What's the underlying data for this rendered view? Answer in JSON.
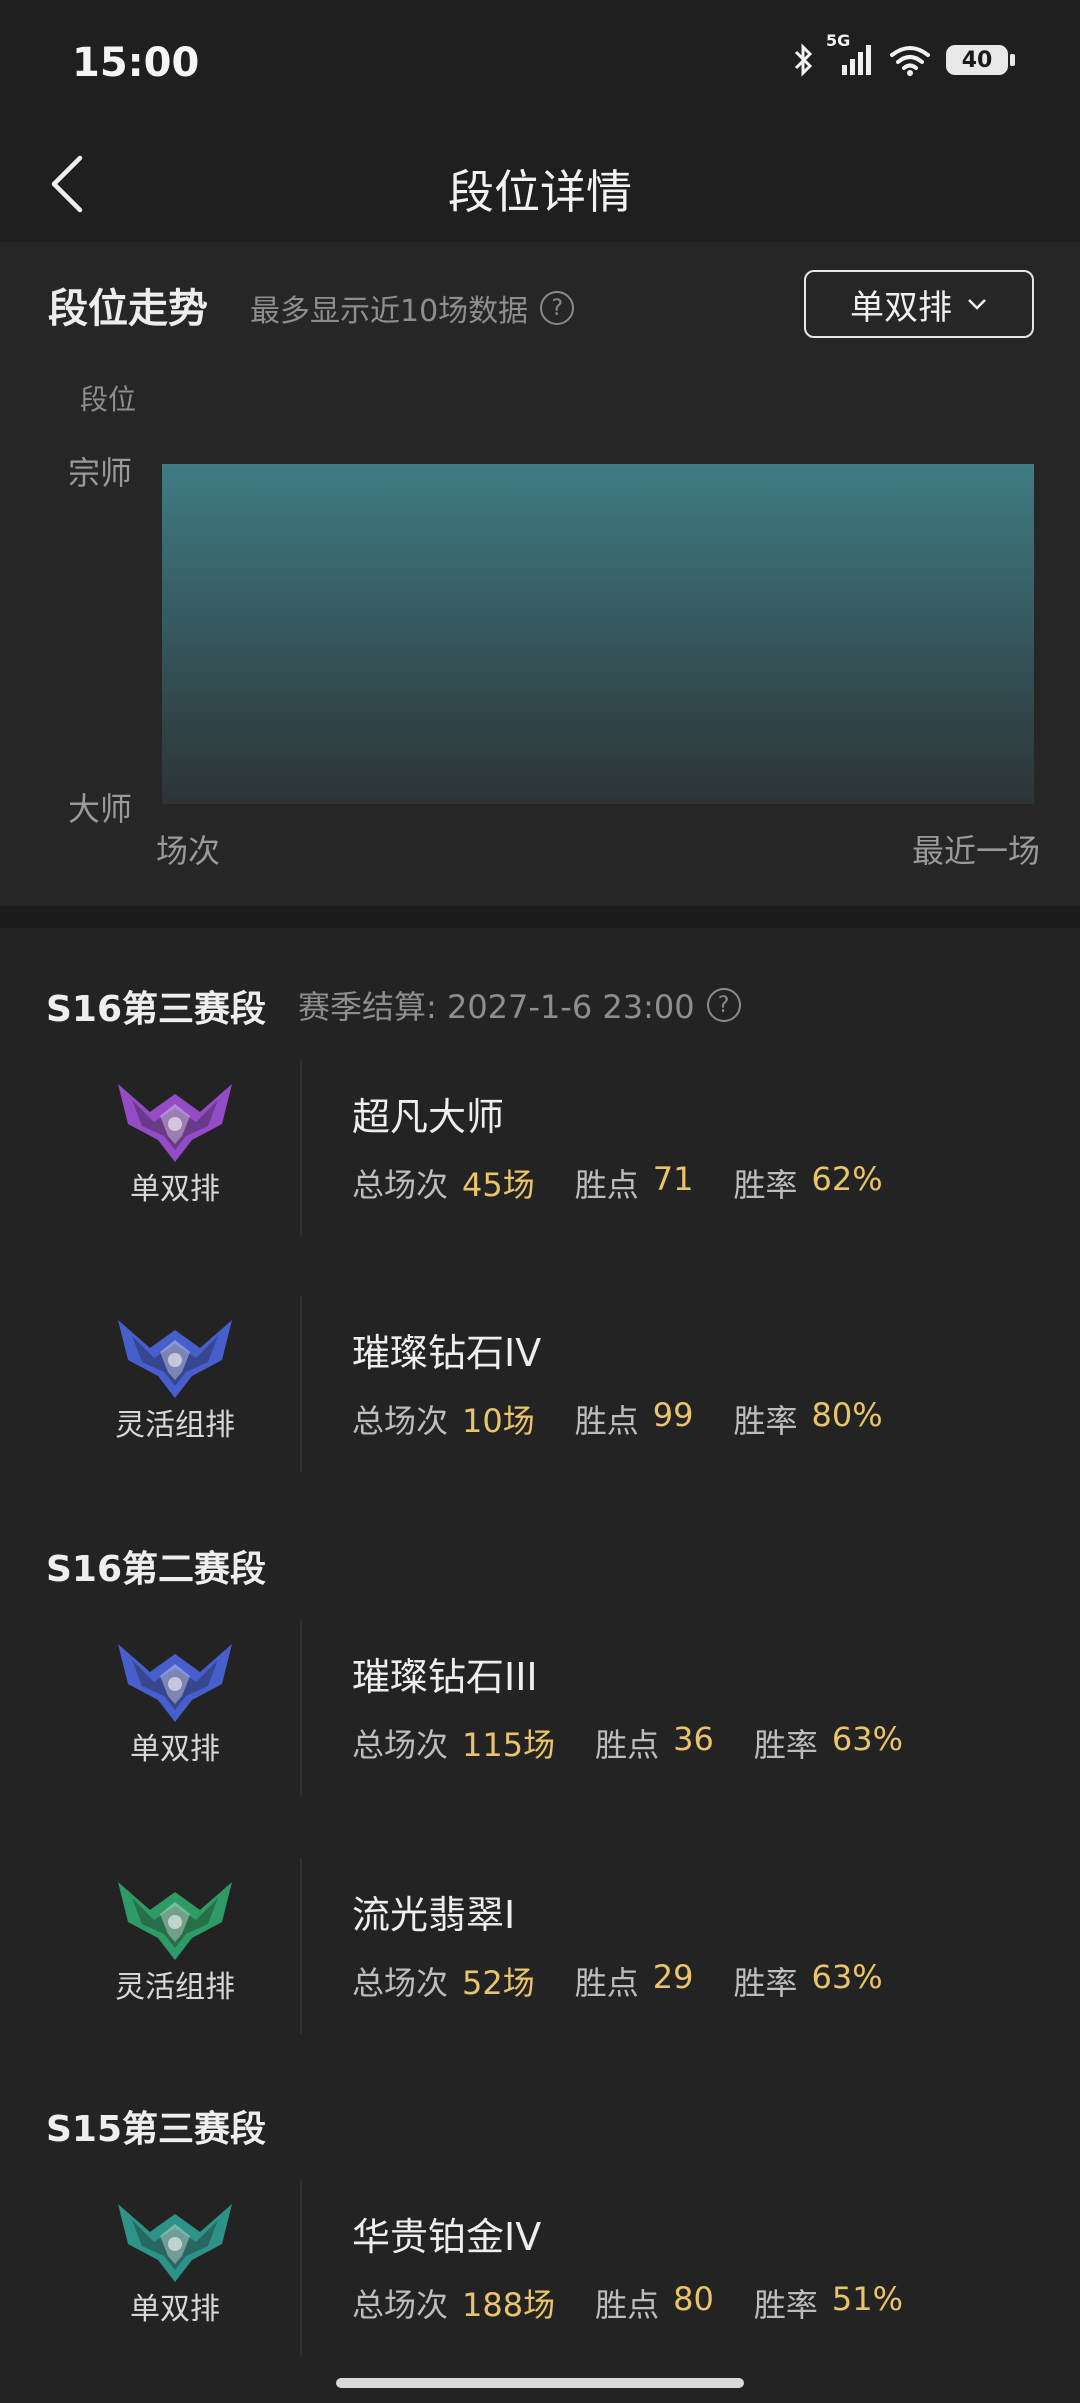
{
  "status_bar": {
    "time": "15:00",
    "battery": "40",
    "network": "5G"
  },
  "nav": {
    "title": "段位详情"
  },
  "trend": {
    "title": "段位走势",
    "subtitle": "最多显示近10场数据",
    "queue_select": "单双排"
  },
  "chart_data": {
    "type": "area",
    "ylabel": "段位",
    "yticks": [
      "宗师",
      "大师"
    ],
    "x_start_label": "场次",
    "x_end_label": "最近一场",
    "series": [
      {
        "values": [
          "宗师",
          "宗师"
        ]
      }
    ],
    "color": "#3f7c84"
  },
  "seasons": [
    {
      "name": "S16第三赛段",
      "note": "赛季结算: 2027-1-6 23:00",
      "entries": [
        {
          "queue": "单双排",
          "rank": "超凡大师",
          "games_label": "总场次",
          "games": "45场",
          "lp_label": "胜点",
          "lp": "71",
          "winrate_label": "胜率",
          "winrate": "62%",
          "emblem": "master-emblem-icon",
          "color": "#9b4fd0"
        },
        {
          "queue": "灵活组排",
          "rank": "璀璨钻石IV",
          "games_label": "总场次",
          "games": "10场",
          "lp_label": "胜点",
          "lp": "99",
          "winrate_label": "胜率",
          "winrate": "80%",
          "emblem": "diamond-emblem-icon",
          "color": "#4a63d6"
        }
      ]
    },
    {
      "name": "S16第二赛段",
      "note": "",
      "entries": [
        {
          "queue": "单双排",
          "rank": "璀璨钻石III",
          "games_label": "总场次",
          "games": "115场",
          "lp_label": "胜点",
          "lp": "36",
          "winrate_label": "胜率",
          "winrate": "63%",
          "emblem": "diamond-emblem-icon",
          "color": "#4a63d6"
        },
        {
          "queue": "灵活组排",
          "rank": "流光翡翠I",
          "games_label": "总场次",
          "games": "52场",
          "lp_label": "胜点",
          "lp": "29",
          "winrate_label": "胜率",
          "winrate": "63%",
          "emblem": "emerald-emblem-icon",
          "color": "#2fa26a"
        }
      ]
    },
    {
      "name": "S15第三赛段",
      "note": "",
      "entries": [
        {
          "queue": "单双排",
          "rank": "华贵铂金IV",
          "games_label": "总场次",
          "games": "188场",
          "lp_label": "胜点",
          "lp": "80",
          "winrate_label": "胜率",
          "winrate": "51%",
          "emblem": "platinum-emblem-icon",
          "color": "#2e9a8e"
        }
      ]
    }
  ]
}
